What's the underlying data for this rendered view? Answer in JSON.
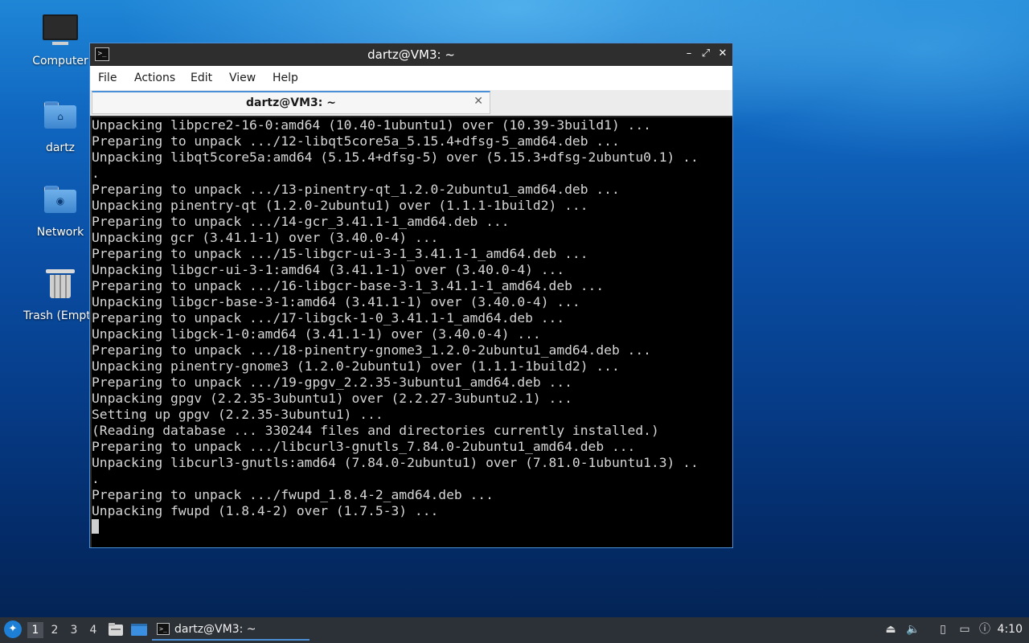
{
  "desktop": {
    "icons": [
      {
        "label": "Computer",
        "icon": "computer-icon"
      },
      {
        "label": "dartz",
        "icon": "home-folder-icon"
      },
      {
        "label": "Network",
        "icon": "network-folder-icon"
      },
      {
        "label": "Trash (Empty)",
        "icon": "trash-icon"
      }
    ]
  },
  "window": {
    "title": "dartz@VM3: ~",
    "controls": {
      "minimize": "–",
      "maximize": "⤢",
      "close": "✕"
    },
    "menu": [
      "File",
      "Actions",
      "Edit",
      "View",
      "Help"
    ],
    "tab": {
      "title": "dartz@VM3: ~",
      "close": "✕"
    },
    "terminal_lines": [
      "Unpacking libpcre2-16-0:amd64 (10.40-1ubuntu1) over (10.39-3build1) ...",
      "Preparing to unpack .../12-libqt5core5a_5.15.4+dfsg-5_amd64.deb ...",
      "Unpacking libqt5core5a:amd64 (5.15.4+dfsg-5) over (5.15.3+dfsg-2ubuntu0.1) ..",
      ".",
      "Preparing to unpack .../13-pinentry-qt_1.2.0-2ubuntu1_amd64.deb ...",
      "Unpacking pinentry-qt (1.2.0-2ubuntu1) over (1.1.1-1build2) ...",
      "Preparing to unpack .../14-gcr_3.41.1-1_amd64.deb ...",
      "Unpacking gcr (3.41.1-1) over (3.40.0-4) ...",
      "Preparing to unpack .../15-libgcr-ui-3-1_3.41.1-1_amd64.deb ...",
      "Unpacking libgcr-ui-3-1:amd64 (3.41.1-1) over (3.40.0-4) ...",
      "Preparing to unpack .../16-libgcr-base-3-1_3.41.1-1_amd64.deb ...",
      "Unpacking libgcr-base-3-1:amd64 (3.41.1-1) over (3.40.0-4) ...",
      "Preparing to unpack .../17-libgck-1-0_3.41.1-1_amd64.deb ...",
      "Unpacking libgck-1-0:amd64 (3.41.1-1) over (3.40.0-4) ...",
      "Preparing to unpack .../18-pinentry-gnome3_1.2.0-2ubuntu1_amd64.deb ...",
      "Unpacking pinentry-gnome3 (1.2.0-2ubuntu1) over (1.1.1-1build2) ...",
      "Preparing to unpack .../19-gpgv_2.2.35-3ubuntu1_amd64.deb ...",
      "Unpacking gpgv (2.2.35-3ubuntu1) over (2.2.27-3ubuntu2.1) ...",
      "Setting up gpgv (2.2.35-3ubuntu1) ...",
      "(Reading database ... 330244 files and directories currently installed.)",
      "Preparing to unpack .../libcurl3-gnutls_7.84.0-2ubuntu1_amd64.deb ...",
      "Unpacking libcurl3-gnutls:amd64 (7.84.0-2ubuntu1) over (7.81.0-1ubuntu1.3) ..",
      ".",
      "Preparing to unpack .../fwupd_1.8.4-2_amd64.deb ...",
      "Unpacking fwupd (1.8.4-2) over (1.7.5-3) ..."
    ]
  },
  "taskbar": {
    "workspaces": [
      "1",
      "2",
      "3",
      "4"
    ],
    "active_workspace": "1",
    "task_label": "dartz@VM3: ~",
    "clock": "4:10",
    "colors": {
      "accent": "#4a90d9",
      "panel": "#2c3037"
    }
  }
}
